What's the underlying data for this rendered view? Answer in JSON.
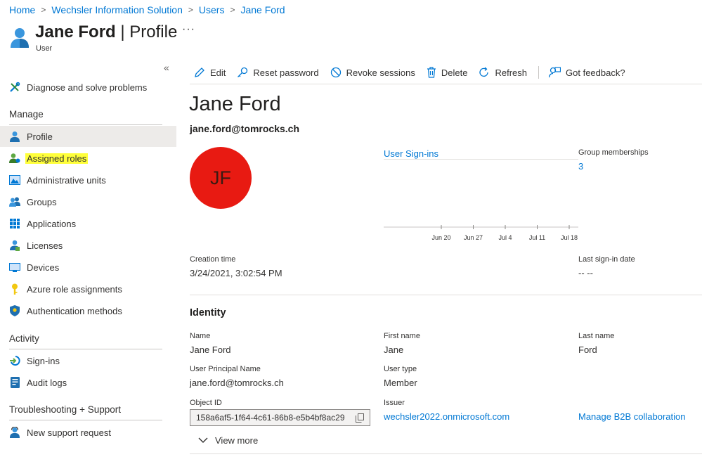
{
  "breadcrumb": {
    "items": [
      "Home",
      "Wechsler Information Solution",
      "Users",
      "Jane Ford"
    ],
    "separator": ">"
  },
  "header": {
    "name": "Jane Ford",
    "pipe": "|",
    "section": "Profile",
    "more": "···",
    "subtitle": "User"
  },
  "sidebar": {
    "collapse": "«",
    "diagnose": "Diagnose and solve problems",
    "manage_heading": "Manage",
    "manage_items": [
      {
        "label": "Profile",
        "icon": "user-icon"
      },
      {
        "label": "Assigned roles",
        "icon": "assigned-roles-icon"
      },
      {
        "label": "Administrative units",
        "icon": "admin-units-icon"
      },
      {
        "label": "Groups",
        "icon": "groups-icon"
      },
      {
        "label": "Applications",
        "icon": "applications-grid-icon"
      },
      {
        "label": "Licenses",
        "icon": "licenses-icon"
      },
      {
        "label": "Devices",
        "icon": "devices-icon"
      },
      {
        "label": "Azure role assignments",
        "icon": "key-icon"
      },
      {
        "label": "Authentication methods",
        "icon": "shield-icon"
      }
    ],
    "activity_heading": "Activity",
    "activity_items": [
      {
        "label": "Sign-ins",
        "icon": "sign-ins-icon"
      },
      {
        "label": "Audit logs",
        "icon": "audit-logs-icon"
      }
    ],
    "support_heading": "Troubleshooting + Support",
    "support_items": [
      {
        "label": "New support request",
        "icon": "support-person-icon"
      }
    ]
  },
  "toolbar": {
    "edit": "Edit",
    "reset_password": "Reset password",
    "revoke_sessions": "Revoke sessions",
    "delete": "Delete",
    "refresh": "Refresh",
    "feedback": "Got feedback?"
  },
  "profile": {
    "display_name": "Jane Ford",
    "email": "jane.ford@tomrocks.ch",
    "initials": "JF",
    "avatar_color": "#e81a12",
    "signins_title": "User Sign-ins",
    "group_memberships_label": "Group memberships",
    "group_memberships_value": "3",
    "creation_time_label": "Creation time",
    "creation_time_value": "3/24/2021, 3:02:54 PM",
    "last_signin_label": "Last sign-in date",
    "last_signin_value": "-- --"
  },
  "chart_data": {
    "type": "line",
    "title": "User Sign-ins",
    "x": [
      "Jun 20",
      "Jun 27",
      "Jul 4",
      "Jul 11",
      "Jul 18"
    ],
    "series": [],
    "grid": false
  },
  "identity": {
    "heading": "Identity",
    "name_label": "Name",
    "name_value": "Jane Ford",
    "first_name_label": "First name",
    "first_name_value": "Jane",
    "last_name_label": "Last name",
    "last_name_value": "Ford",
    "upn_label": "User Principal Name",
    "upn_value": "jane.ford@tomrocks.ch",
    "user_type_label": "User type",
    "user_type_value": "Member",
    "object_id_label": "Object ID",
    "object_id_value": "158a6af5-1f64-4c61-86b8-e5b4bf8ac29",
    "issuer_label": "Issuer",
    "issuer_value": "wechsler2022.onmicrosoft.com",
    "manage_b2b": "Manage B2B collaboration",
    "view_more": "View more"
  },
  "colors": {
    "accent": "#0078d4",
    "highlight": "#ffff3a",
    "active_bg": "#edebe9"
  }
}
